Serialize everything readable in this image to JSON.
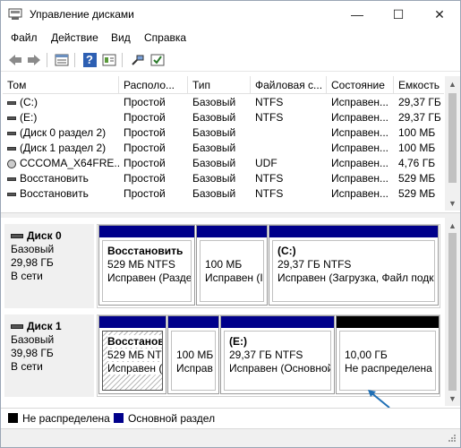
{
  "window": {
    "title": "Управление дисками",
    "minimize": "—",
    "maximize": "☐",
    "close": "✕"
  },
  "menu": [
    "Файл",
    "Действие",
    "Вид",
    "Справка"
  ],
  "toolbar": {
    "back": "back-arrow-icon",
    "forward": "forward-arrow-icon",
    "properties": "properties-icon",
    "help": "help-icon",
    "help_glyph": "?",
    "view": "view-icon",
    "connect": "connect-icon",
    "check": "check-icon"
  },
  "columns": [
    "Том",
    "Располо...",
    "Тип",
    "Файловая с...",
    "Состояние",
    "Емкость"
  ],
  "volumes": [
    {
      "name": "(C:)",
      "layout": "Простой",
      "type": "Базовый",
      "fs": "NTFS",
      "status": "Исправен...",
      "capacity": "29,37 ГБ",
      "icon": "drive"
    },
    {
      "name": "(E:)",
      "layout": "Простой",
      "type": "Базовый",
      "fs": "NTFS",
      "status": "Исправен...",
      "capacity": "29,37 ГБ",
      "icon": "drive"
    },
    {
      "name": "(Диск 0 раздел 2)",
      "layout": "Простой",
      "type": "Базовый",
      "fs": "",
      "status": "Исправен...",
      "capacity": "100 МБ",
      "icon": "drive"
    },
    {
      "name": "(Диск 1 раздел 2)",
      "layout": "Простой",
      "type": "Базовый",
      "fs": "",
      "status": "Исправен...",
      "capacity": "100 МБ",
      "icon": "drive"
    },
    {
      "name": "CCCOMA_X64FRE...",
      "layout": "Простой",
      "type": "Базовый",
      "fs": "UDF",
      "status": "Исправен...",
      "capacity": "4,76 ГБ",
      "icon": "cd"
    },
    {
      "name": "Восстановить",
      "layout": "Простой",
      "type": "Базовый",
      "fs": "NTFS",
      "status": "Исправен...",
      "capacity": "529 МБ",
      "icon": "drive"
    },
    {
      "name": "Восстановить",
      "layout": "Простой",
      "type": "Базовый",
      "fs": "NTFS",
      "status": "Исправен...",
      "capacity": "529 МБ",
      "icon": "drive"
    }
  ],
  "disks": [
    {
      "title": "Диск 0",
      "type": "Базовый",
      "size": "29,98 ГБ",
      "state": "В сети",
      "parts": [
        {
          "name": "Восстановить",
          "size": "529 МБ NTFS",
          "status": "Исправен (Разде",
          "color": "#00008b"
        },
        {
          "name": "",
          "size": "100 МБ",
          "status": "Исправен (І",
          "color": "#00008b"
        },
        {
          "name": "(C:)",
          "size": "29,37 ГБ NTFS",
          "status": "Исправен (Загрузка, Файл подк",
          "color": "#00008b"
        }
      ]
    },
    {
      "title": "Диск 1",
      "type": "Базовый",
      "size": "39,98 ГБ",
      "state": "В сети",
      "parts": [
        {
          "name": "Восстанові",
          "size": "529 МБ NTF",
          "status": "Исправен (І",
          "color": "#00008b"
        },
        {
          "name": "",
          "size": "100 МБ",
          "status": "Исправ",
          "color": "#00008b"
        },
        {
          "name": "(E:)",
          "size": "29,37 ГБ NTFS",
          "status": "Исправен (Основной",
          "color": "#00008b"
        },
        {
          "name": "",
          "size": "10,00 ГБ",
          "status": "Не распределена",
          "color": "#000000"
        }
      ]
    }
  ],
  "legend": [
    {
      "label": "Не распределена",
      "color": "#000000"
    },
    {
      "label": "Основной раздел",
      "color": "#00008b"
    }
  ],
  "colors": {
    "primary": "#00008b",
    "unallocated": "#000000",
    "arrow": "#1f6fb5"
  }
}
